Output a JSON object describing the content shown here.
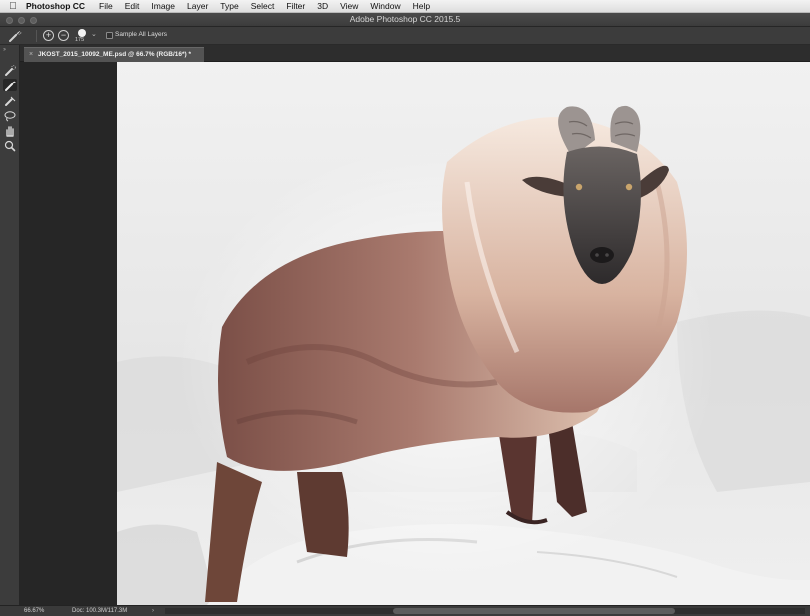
{
  "menubar": {
    "app_name": "Photoshop CC",
    "items": [
      "File",
      "Edit",
      "Image",
      "Layer",
      "Type",
      "Select",
      "Filter",
      "3D",
      "View",
      "Window",
      "Help"
    ]
  },
  "window": {
    "title": "Adobe Photoshop CC 2015.5"
  },
  "options_bar": {
    "tool_icon": "quick-selection-icon",
    "add_icon": "add-to-selection-icon",
    "subtract_icon": "subtract-from-selection-icon",
    "brush_size": "175",
    "sample_all_layers_label": "Sample All Layers",
    "sample_all_layers_checked": false
  },
  "tools": [
    {
      "icon": "quick-selection-icon",
      "active": false
    },
    {
      "icon": "refine-radius-icon",
      "active": true
    },
    {
      "icon": "erase-refinements-icon",
      "active": false
    },
    {
      "icon": "lasso-icon",
      "active": false
    },
    {
      "icon": "hand-icon",
      "active": false
    },
    {
      "icon": "zoom-icon",
      "active": false
    }
  ],
  "document": {
    "tab_title": "JKOST_2015_10092_ME.psd @ 66.7% (RGB/16*) *",
    "close_glyph": "×"
  },
  "status_bar": {
    "zoom": "66.67%",
    "doc_info": "Doc: 100.3M/117.3M",
    "caret": "›"
  },
  "colors": {
    "accent": "#3c3c3c",
    "canvas_bg": "#ebebeb"
  }
}
